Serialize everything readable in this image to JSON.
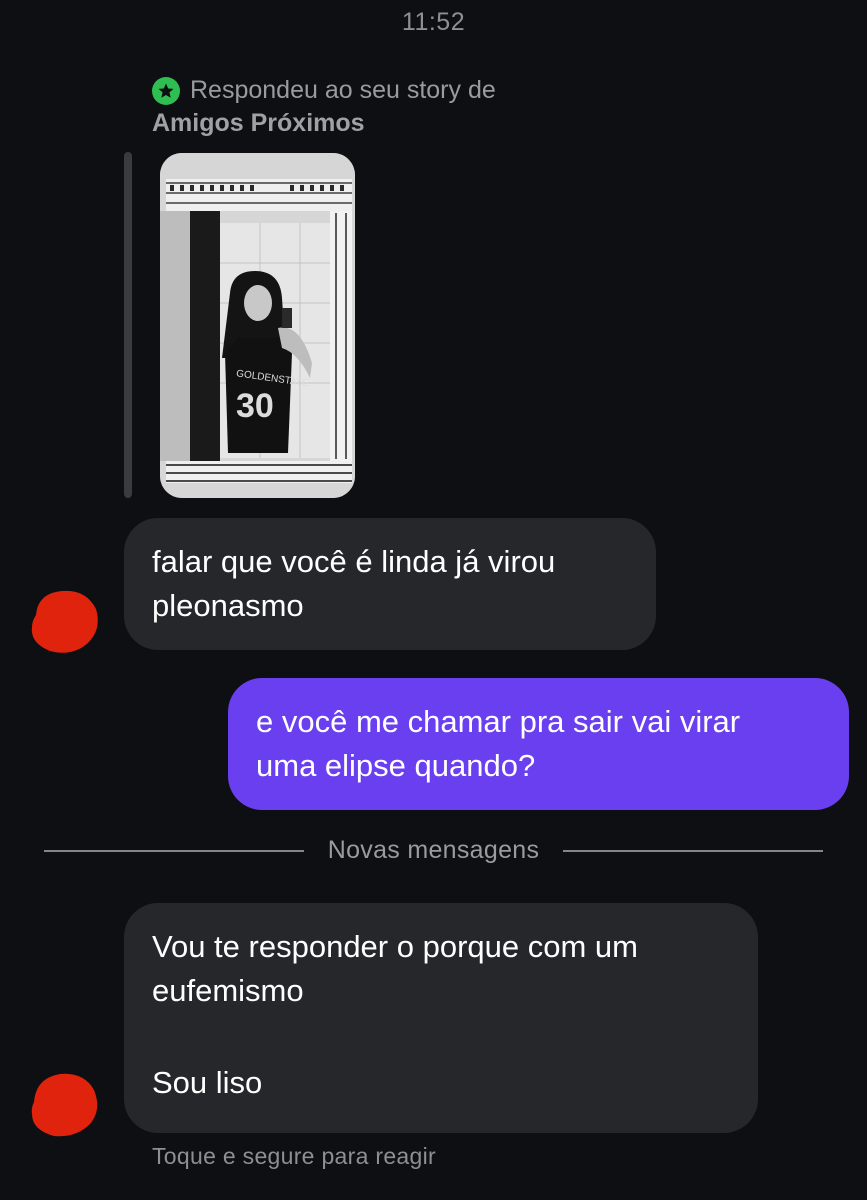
{
  "status": {
    "time": "11:52"
  },
  "story_reply": {
    "line1": "Respondeu ao seu story de",
    "line2": "Amigos Próximos",
    "badge_icon": "star-icon",
    "badge_color": "#2fbe51"
  },
  "messages": [
    {
      "from": "them",
      "lines": [
        "falar que você é linda já virou",
        "pleonasmo"
      ]
    },
    {
      "from": "me",
      "lines": [
        "e você me chamar pra sair vai virar",
        "uma elipse quando?"
      ]
    },
    {
      "from": "them",
      "lines": [
        "Vou te responder o porque com um",
        "eufemismo",
        "Sou liso"
      ]
    }
  ],
  "divider": {
    "label": "Novas mensagens"
  },
  "footer": {
    "hint": "Toque e segure para reagir"
  },
  "colors": {
    "background": "#0d0f13",
    "incoming_bubble": "#26272b",
    "outgoing_bubble": "#6a3ff0",
    "avatar_redaction": "#e0230d"
  }
}
